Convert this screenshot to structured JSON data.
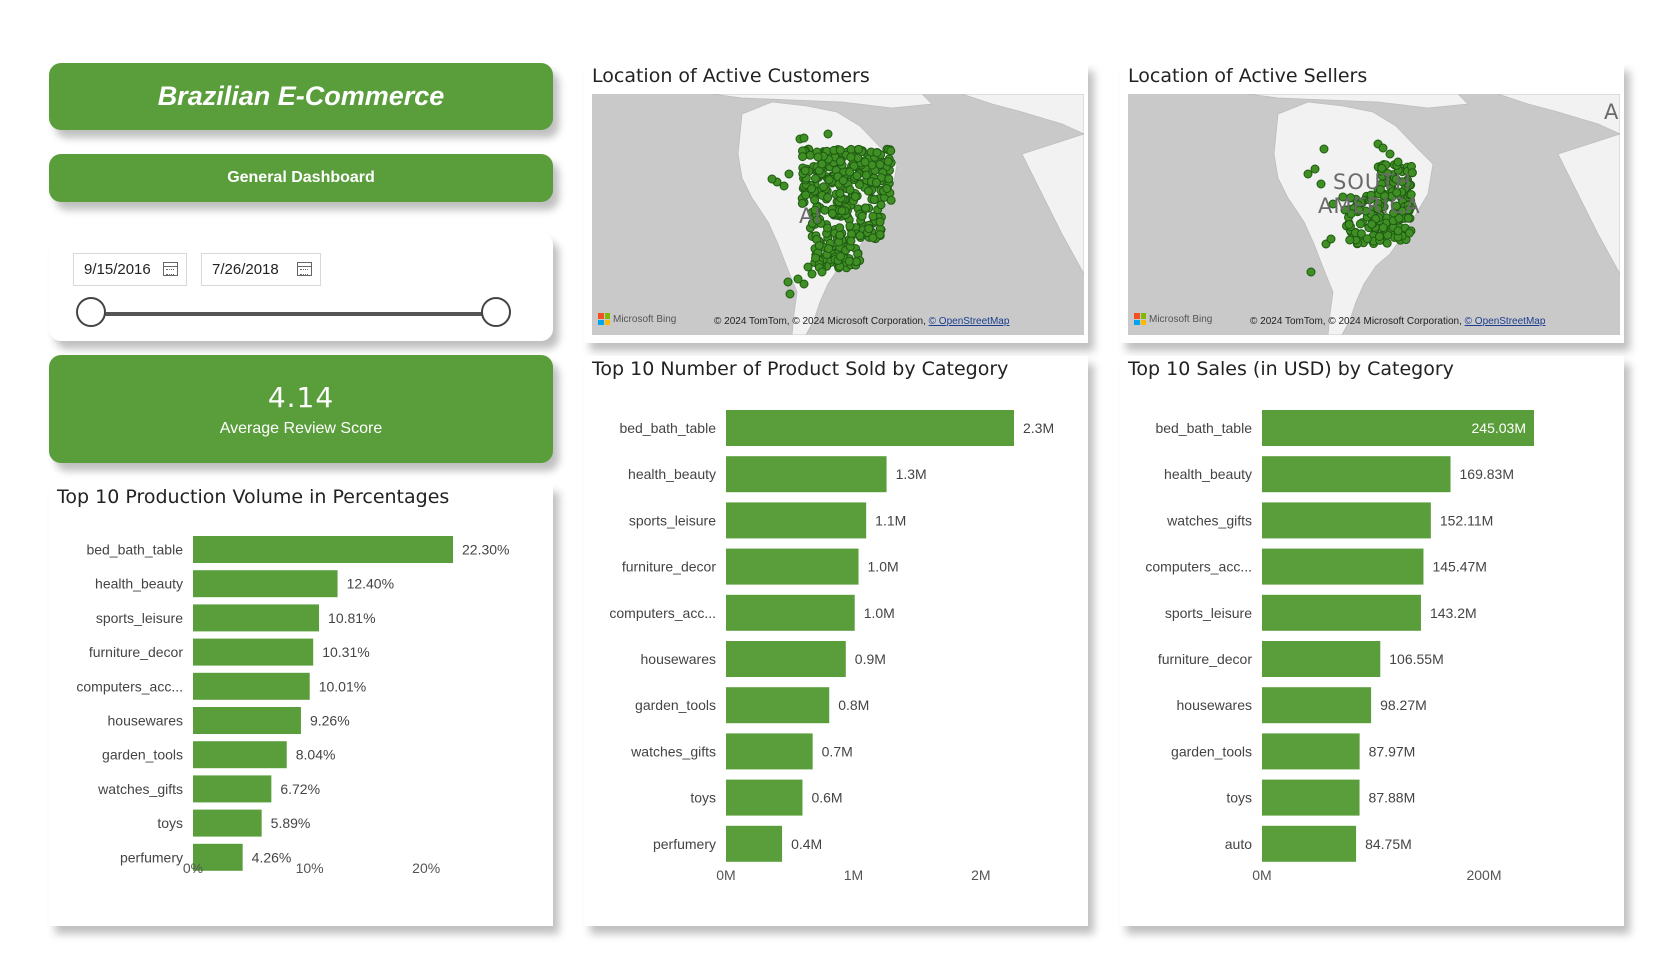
{
  "header": {
    "title": "Brazilian E-Commerce",
    "subtitle": "General Dashboard"
  },
  "date_filter": {
    "start": "9/15/2016",
    "end": "7/26/2018"
  },
  "kpi": {
    "value": "4.14",
    "label": "Average Review Score"
  },
  "maps": {
    "customers_title": "Location of Active Customers",
    "sellers_title": "Location of Active Sellers",
    "bing_label": "Microsoft Bing",
    "attribution": "© 2024 TomTom, © 2024 Microsoft Corporation,",
    "attribution_link": "© OpenStreetMap",
    "customers_label": "AI",
    "sellers_label_1": "SOUTH",
    "sellers_label_2": "AMERICA",
    "sellers_corner_label": "A"
  },
  "colors": {
    "accent": "#5a9e3c",
    "bar": "#5a9e3c",
    "map_bg": "#c9c9c9",
    "land": "#f2f2f2",
    "marker": "#3f8f25"
  },
  "chart_data": [
    {
      "type": "bar",
      "orientation": "horizontal",
      "title": "Top 10 Production Volume in Percentages",
      "categories": [
        "bed_bath_table",
        "health_beauty",
        "sports_leisure",
        "furniture_decor",
        "computers_acc...",
        "housewares",
        "garden_tools",
        "watches_gifts",
        "toys",
        "perfumery"
      ],
      "values": [
        22.3,
        12.4,
        10.81,
        10.31,
        10.01,
        9.26,
        8.04,
        6.72,
        5.89,
        4.26
      ],
      "data_labels": [
        "22.30%",
        "12.40%",
        "10.81%",
        "10.31%",
        "10.01%",
        "9.26%",
        "8.04%",
        "6.72%",
        "5.89%",
        "4.26%"
      ],
      "xlim": [
        0,
        27
      ],
      "ticks": [
        0,
        10,
        20
      ],
      "tick_labels": [
        "0%",
        "10%",
        "20%"
      ]
    },
    {
      "type": "bar",
      "orientation": "horizontal",
      "title": "Top 10 Number of Product Sold by Category",
      "categories": [
        "bed_bath_table",
        "health_beauty",
        "sports_leisure",
        "furniture_decor",
        "computers_acc...",
        "housewares",
        "garden_tools",
        "watches_gifts",
        "toys",
        "perfumery"
      ],
      "values": [
        2.26,
        1.26,
        1.1,
        1.04,
        1.01,
        0.94,
        0.81,
        0.68,
        0.6,
        0.44
      ],
      "data_labels": [
        "2.3M",
        "1.3M",
        "1.1M",
        "1.0M",
        "1.0M",
        "0.9M",
        "0.8M",
        "0.7M",
        "0.6M",
        "0.4M"
      ],
      "xlim": [
        0,
        2.7
      ],
      "ticks": [
        0,
        1,
        2
      ],
      "tick_labels": [
        "0M",
        "1M",
        "2M"
      ]
    },
    {
      "type": "bar",
      "orientation": "horizontal",
      "title": "Top 10 Sales (in USD) by Category",
      "categories": [
        "bed_bath_table",
        "health_beauty",
        "watches_gifts",
        "computers_acc...",
        "sports_leisure",
        "furniture_decor",
        "housewares",
        "garden_tools",
        "toys",
        "auto"
      ],
      "values": [
        245.03,
        169.83,
        152.11,
        145.47,
        143.2,
        106.55,
        98.27,
        87.97,
        87.88,
        84.75
      ],
      "data_labels": [
        "245.03M",
        "169.83M",
        "152.11M",
        "145.47M",
        "143.2M",
        "106.55M",
        "98.27M",
        "87.97M",
        "87.88M",
        "84.75M"
      ],
      "xlim": [
        0,
        400
      ],
      "ticks": [
        0,
        200
      ],
      "tick_labels": [
        "0M",
        "200M"
      ],
      "first_label_inside": true
    }
  ]
}
